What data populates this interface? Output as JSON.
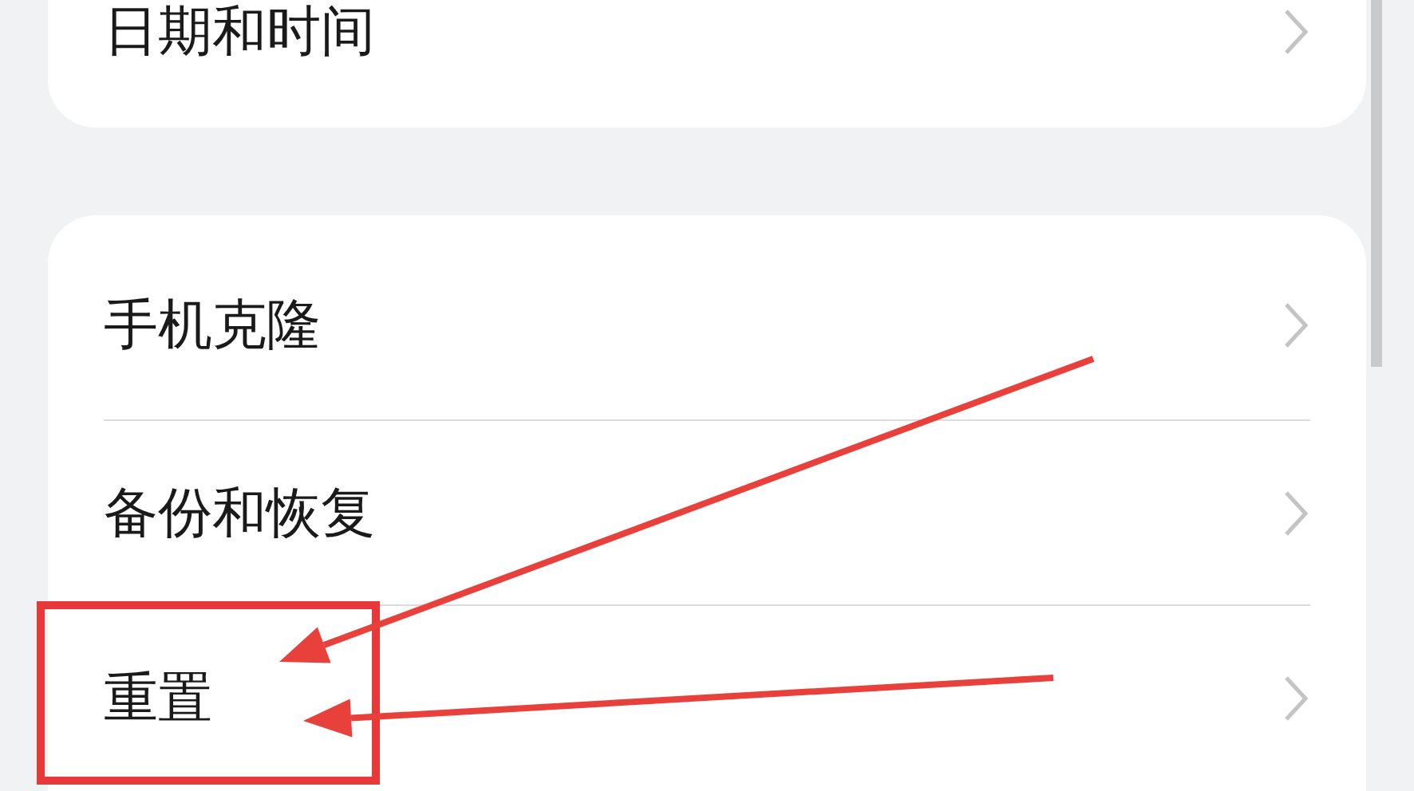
{
  "groups": [
    {
      "rows": [
        {
          "label": "日期和时间"
        }
      ]
    },
    {
      "rows": [
        {
          "label": "手机克隆"
        },
        {
          "label": "备份和恢复"
        },
        {
          "label": "重置"
        }
      ]
    }
  ]
}
